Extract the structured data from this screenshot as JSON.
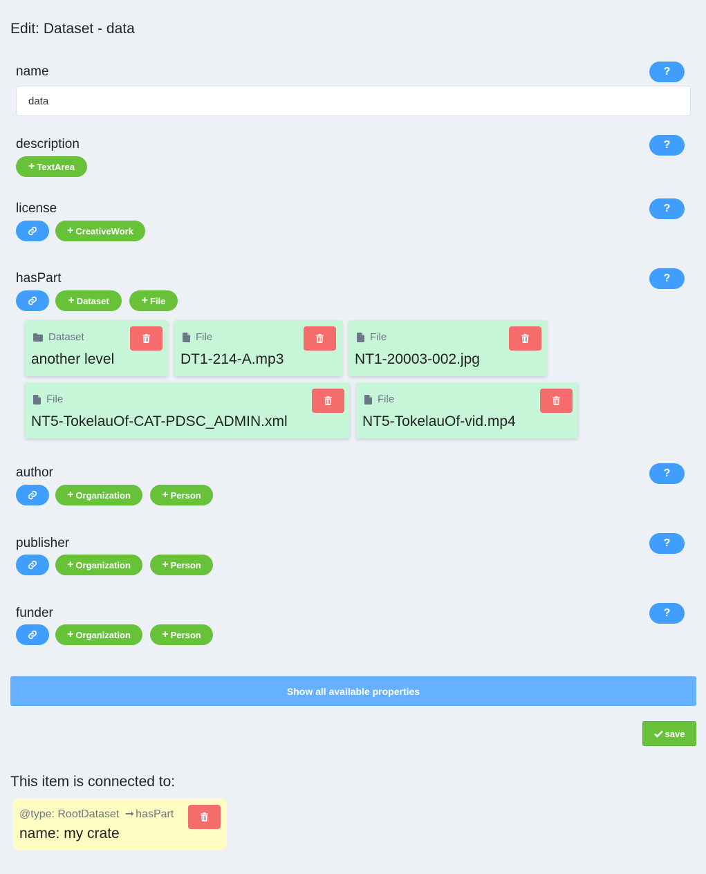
{
  "page_title": "Edit: Dataset - data",
  "help_label": "?",
  "properties": {
    "name": {
      "label": "name",
      "value": "data"
    },
    "description": {
      "label": "description",
      "add_textarea": "TextArea"
    },
    "license": {
      "label": "license",
      "add_creativework": "CreativeWork"
    },
    "hasPart": {
      "label": "hasPart",
      "add_dataset": "Dataset",
      "add_file": "File"
    },
    "author": {
      "label": "author",
      "add_org": "Organization",
      "add_person": "Person"
    },
    "publisher": {
      "label": "publisher",
      "add_org": "Organization",
      "add_person": "Person"
    },
    "funder": {
      "label": "funder",
      "add_org": "Organization",
      "add_person": "Person"
    }
  },
  "parts": [
    {
      "type": "Dataset",
      "icon": "folder-icon",
      "name": "another level"
    },
    {
      "type": "File",
      "icon": "file-icon",
      "name": "DT1-214-A.mp3"
    },
    {
      "type": "File",
      "icon": "file-icon",
      "name": "NT1-20003-002.jpg"
    },
    {
      "type": "File",
      "icon": "file-icon",
      "name": "NT5-TokelauOf-CAT-PDSC_ADMIN.xml"
    },
    {
      "type": "File",
      "icon": "file-icon",
      "name": "NT5-TokelauOf-vid.mp4"
    }
  ],
  "show_all_label": "Show all available properties",
  "save_label": "save",
  "connected": {
    "title": "This item is connected to:",
    "type_text": "@type: RootDataset",
    "property": "hasPart",
    "name_text": "name: my crate"
  },
  "colors": {
    "help_blue": "#409eff",
    "add_green": "#67c23a",
    "delete_red": "#f56c6c",
    "card_green": "#c7f5d7",
    "connected_yellow": "#fffcc2",
    "show_all_blue": "#66b1ff"
  }
}
